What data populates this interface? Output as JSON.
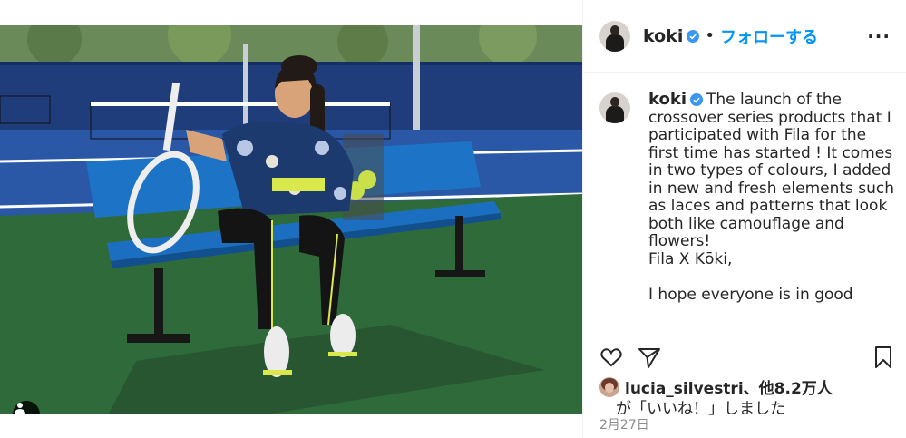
{
  "post": {
    "username": "koki",
    "follow_label": "フォローする",
    "separator": "•",
    "more_label": "···"
  },
  "caption": {
    "username": "koki",
    "text": "The launch of the crossover series products that I participated with Fila for the first time has started ! It comes in two types of colours, I added in new and fresh elements such as laces and patterns that look both like camouflage and flowers!\nFila X Kōki,\n\nI hope everyone is in good"
  },
  "likes": {
    "liker": "lucia_silvestri",
    "suffix": "、他8.2万人",
    "line2": "が「いいね！」しました"
  },
  "date": "2月27日",
  "icons": {
    "verified": "verified-badge-icon",
    "like": "heart-icon",
    "share": "paper-plane-icon",
    "save": "bookmark-icon",
    "tags": "user-tag-icon"
  },
  "colors": {
    "accent": "#0095f6",
    "text": "#262626",
    "muted": "#8e8e8e",
    "border": "#efefef"
  }
}
